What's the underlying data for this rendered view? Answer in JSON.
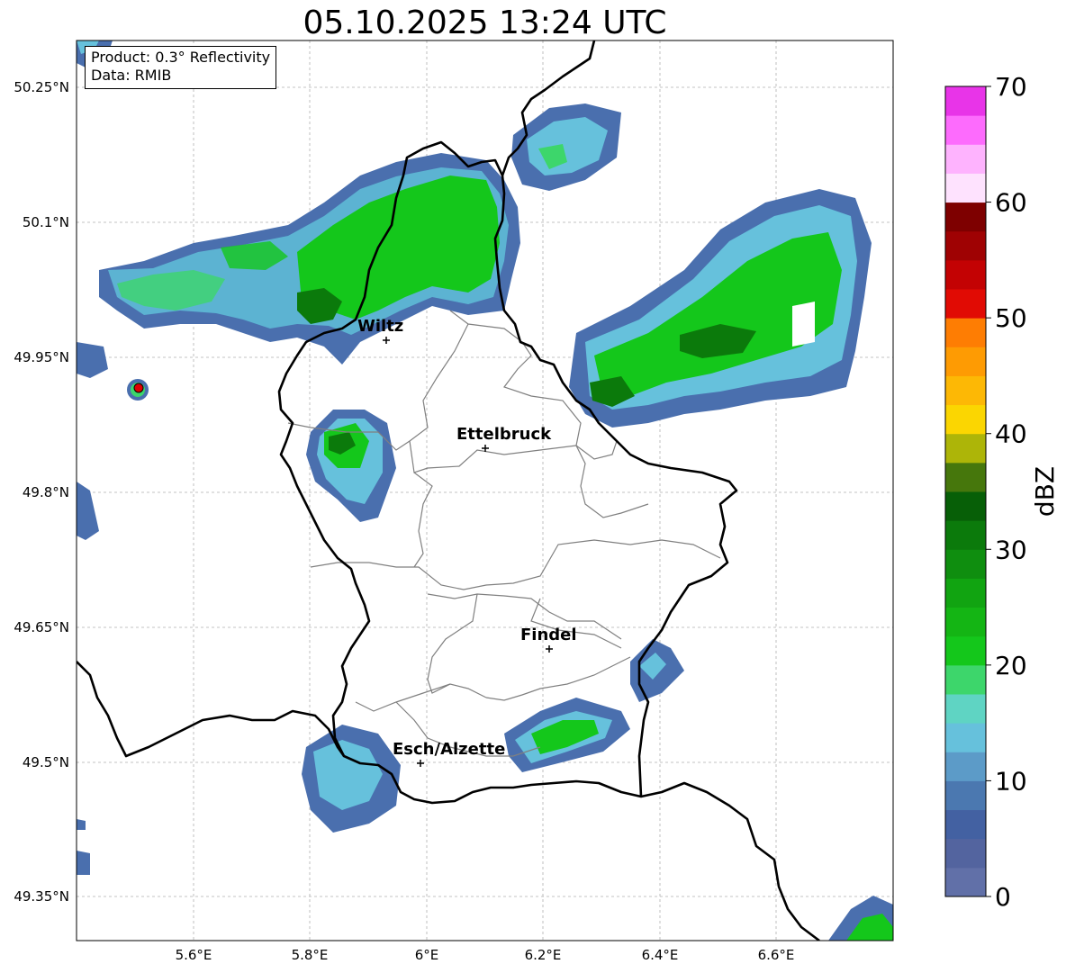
{
  "title": "05.10.2025 13:24 UTC",
  "info_box": {
    "product": "Product: 0.3° Reflectivity",
    "data": "Data: RMIB"
  },
  "map": {
    "lat_ticks": [
      "50.25°N",
      "50.1°N",
      "49.95°N",
      "49.8°N",
      "49.65°N",
      "49.5°N",
      "49.35°N"
    ],
    "lon_ticks": [
      "5.6°E",
      "5.8°E",
      "6°E",
      "6.2°E",
      "6.4°E",
      "6.6°E"
    ],
    "cities": [
      "Wiltz",
      "Ettelbruck",
      "Findel",
      "Esch/Alzette"
    ],
    "border_color": "#000000",
    "canton_border_color": "#808080"
  },
  "colorbar": {
    "label": "dBZ",
    "ticks": [
      "0",
      "10",
      "20",
      "30",
      "40",
      "50",
      "60",
      "70"
    ],
    "colors": [
      "#6170a8",
      "#53649f",
      "#4361a2",
      "#4b78b0",
      "#5c9bc8",
      "#66c1dc",
      "#5fd4c3",
      "#3dd66b",
      "#14c71b",
      "#14b514",
      "#11a411",
      "#0f8e0f",
      "#0b7a0b",
      "#075f07",
      "#46770c",
      "#adb508",
      "#fbd601",
      "#fdb805",
      "#fe9b03",
      "#fe7d03",
      "#e10b04",
      "#c30203",
      "#9f0203",
      "#7e0000",
      "#fee2fe",
      "#feb3fe",
      "#fd6bfd",
      "#e834e8"
    ]
  }
}
